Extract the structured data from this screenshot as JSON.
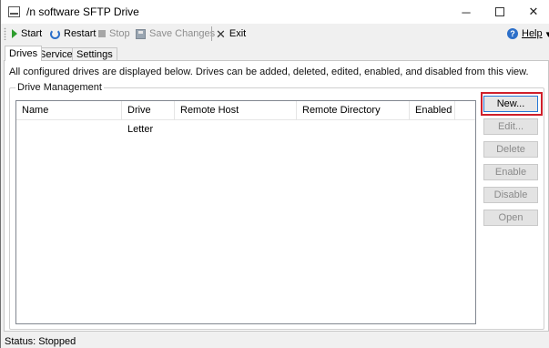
{
  "window": {
    "title": "/n software SFTP Drive",
    "minimize": "─",
    "close": "✕"
  },
  "toolbar": {
    "start": "Start",
    "restart": "Restart",
    "stop": "Stop",
    "save_changes": "Save Changes",
    "exit": "Exit",
    "help": "Help",
    "help_arrow": "▾"
  },
  "tabs": [
    {
      "label": "Drives",
      "active": true
    },
    {
      "label": "Service",
      "active": false
    },
    {
      "label": "Settings",
      "active": false
    }
  ],
  "drives": {
    "description": "All configured drives are displayed below. Drives can be added, deleted, edited, enabled, and disabled from this view.",
    "group_label": "Drive Management",
    "columns": [
      "Name",
      "Drive Letter",
      "Remote Host",
      "Remote Directory",
      "Enabled"
    ],
    "rows": [],
    "buttons": {
      "new": "New...",
      "edit": "Edit...",
      "delete": "Delete",
      "enable": "Enable",
      "disable": "Disable",
      "open": "Open"
    }
  },
  "status": {
    "text": "Status: Stopped"
  },
  "colors": {
    "highlight": "#d0202b",
    "focus_border": "#2778d6",
    "window_bg": "#f0f0f0"
  }
}
